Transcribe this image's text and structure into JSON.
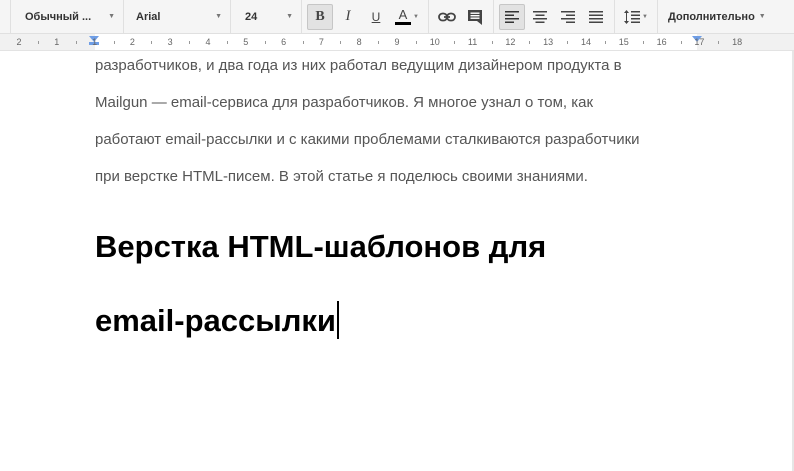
{
  "toolbar": {
    "style_select": "Обычный ...",
    "font_select": "Arial",
    "size_select": "24",
    "bold_label": "B",
    "italic_label": "I",
    "underline_label": "U",
    "text_color_label": "A",
    "more_label": "Дополнительно",
    "icons": [
      "link-icon",
      "comment-icon",
      "align-left-icon",
      "align-center-icon",
      "align-right-icon",
      "align-justify-icon",
      "line-spacing-icon"
    ]
  },
  "ruler": {
    "numbers": [
      "2",
      "1",
      "1",
      "2",
      "3",
      "4",
      "5",
      "6",
      "7",
      "8",
      "9",
      "10",
      "11",
      "12",
      "13",
      "14",
      "15",
      "16",
      "17",
      "18"
    ]
  },
  "document": {
    "lines": [
      "разработчиков, и два года из них работал ведущим дизайнером продукта в",
      "Mailgun — email-сервиса для разработчиков. Я многое узнал о том, как",
      "работают email-рассылки и с какими проблемами сталкиваются разработчики",
      "при верстке HTML-писем. В этой статье я поделюсь своими знаниями."
    ],
    "heading_line1": "Верстка HTML-шаблонов для",
    "heading_line2": "email-рассылки"
  },
  "colors": {
    "toolbar_bg": "#f5f5f5",
    "indent_marker": "#6f9ee6",
    "body_text": "#555555",
    "heading_text": "#000000"
  }
}
